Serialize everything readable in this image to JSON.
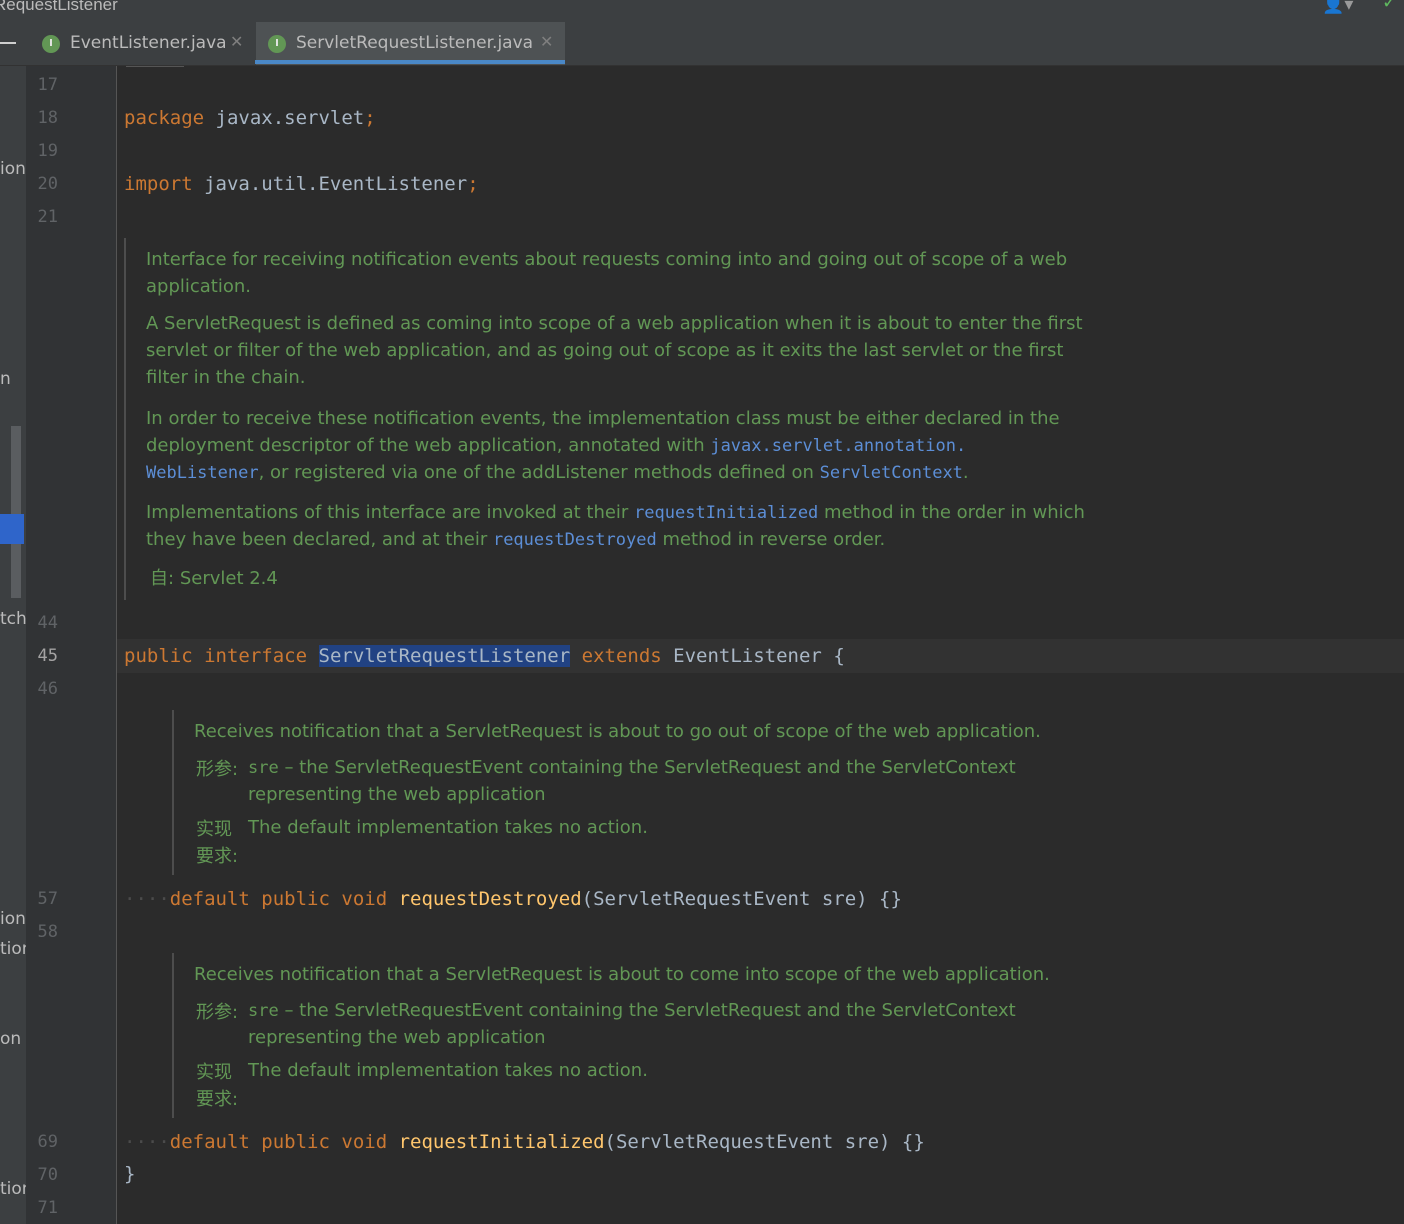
{
  "window": {
    "title": "RequestListener"
  },
  "tabs": [
    {
      "label": "EventListener.java",
      "icon": "I",
      "active": false
    },
    {
      "label": "ServletRequestListener.java",
      "icon": "I",
      "active": true
    }
  ],
  "left_strip": {
    "fragments": [
      "ion",
      "n",
      "tch",
      "ion",
      "tion",
      "on",
      "tion"
    ]
  },
  "gutter": {
    "line_numbers": [
      "17",
      "18",
      "19",
      "20",
      "21",
      "44",
      "45",
      "46",
      "57",
      "58",
      "69",
      "70",
      "71"
    ],
    "current_line": "45"
  },
  "code": {
    "package_kw": "package",
    "package_name": "javax.servlet",
    "semi1": ";",
    "import_kw": "import",
    "import_name": "java.util.EventListener",
    "semi2": ";",
    "decl_public": "public",
    "decl_interface": "interface",
    "decl_name": "ServletRequestListener",
    "decl_extends": "extends",
    "decl_super": "EventListener",
    "decl_brace": "{",
    "m1_dots": "····",
    "m1_default": "default",
    "m1_public": "public",
    "m1_void": "void",
    "m1_name": "requestDestroyed",
    "m1_params": "(ServletRequestEvent sre) {}",
    "m2_dots": "····",
    "m2_default": "default",
    "m2_public": "public",
    "m2_void": "void",
    "m2_name": "requestInitialized",
    "m2_params": "(ServletRequestEvent sre) {}",
    "close_brace": "}"
  },
  "doc_interface": {
    "p1a": "Interface for receiving notification events about requests coming into and going out of scope of a web",
    "p1b": "application.",
    "p2a": "A ServletRequest is defined as coming into scope of a web application when it is about to enter the first",
    "p2b": "servlet or filter of the web application, and as going out of scope as it exits the last servlet or the first",
    "p2c": "filter in the chain.",
    "p3a": "In order to receive these notification events, the implementation class must be either declared in the",
    "p3b_text": "deployment descriptor of the web application, annotated with ",
    "p3b_code": "javax.servlet.annotation.",
    "p3c_code1": "WebListener",
    "p3c_text1": ", or registered via one of the addListener methods defined on ",
    "p3c_code2": "ServletContext",
    "p3c_text2": ".",
    "p4a_text1": "Implementations of this interface are invoked at their ",
    "p4a_code": "requestInitialized",
    "p4a_text2": " method in the order in which",
    "p4b_text1": "they have been declared, and at their ",
    "p4b_code": "requestDestroyed",
    "p4b_text2": " method in reverse order.",
    "since_label": "自:",
    "since_value": "Servlet 2.4"
  },
  "doc_destroyed": {
    "summary": "Receives notification that a ServletRequest is about to go out of scope of the web application.",
    "param_label": "形参:",
    "param_name": "sre",
    "param_text1": " – the ServletRequestEvent containing the ServletRequest and the ServletContext",
    "param_text2": "representing the web application",
    "impl_label1": "实现",
    "impl_label2": "要求:",
    "impl_text": "The default implementation takes no action."
  },
  "doc_initialized": {
    "summary": "Receives notification that a ServletRequest is about to come into scope of the web application.",
    "param_label": "形参:",
    "param_name": "sre",
    "param_text1": " – the ServletRequestEvent containing the ServletRequest and the ServletContext",
    "param_text2": "representing the web application",
    "impl_label1": "实现",
    "impl_label2": "要求:",
    "impl_text": "The default implementation takes no action."
  },
  "colors": {
    "keyword": "#cc7832",
    "function": "#ffc66d",
    "doc": "#629755",
    "doc_code": "#5c8ed6",
    "tab_underline": "#4a88c7",
    "selection": "#214283"
  }
}
